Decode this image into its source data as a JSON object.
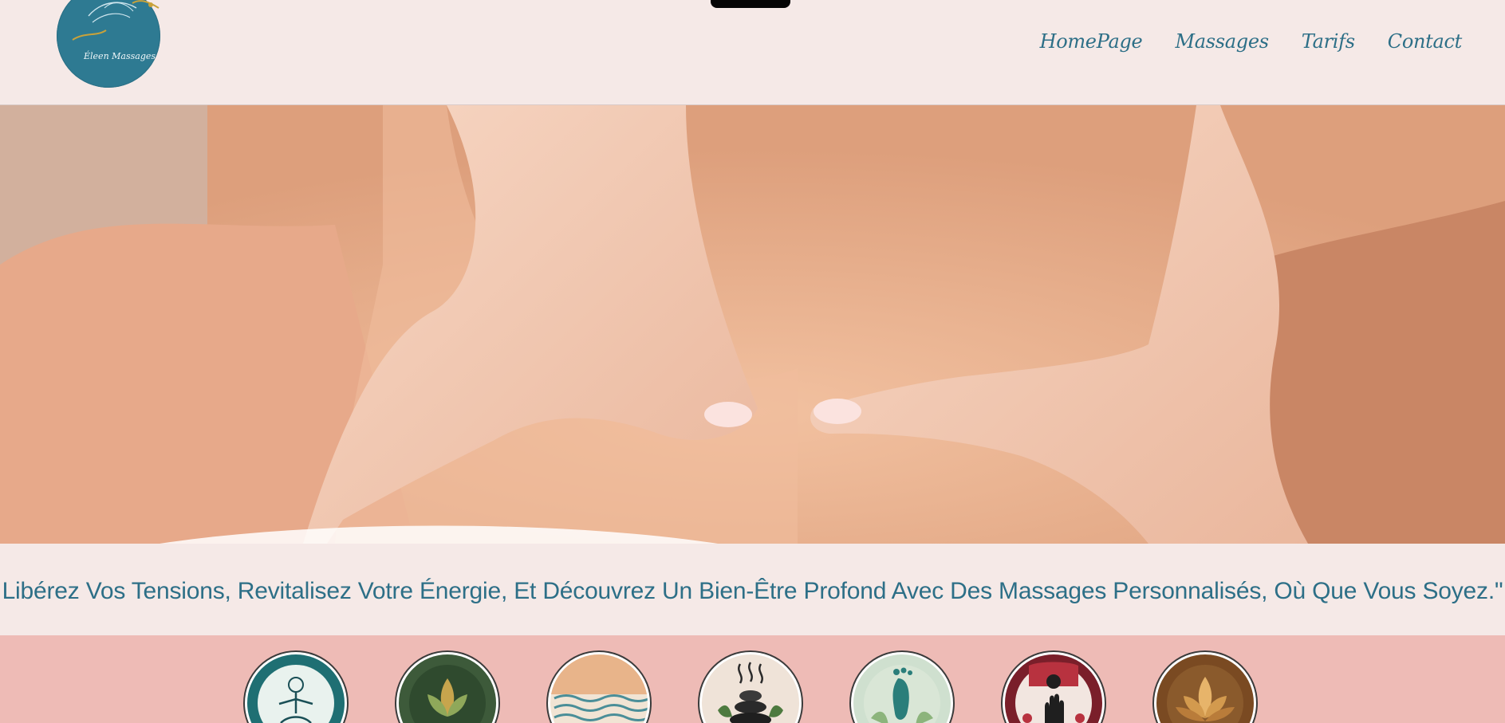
{
  "header": {
    "logo_text": "Éleen Massages",
    "nav": [
      {
        "label": "HomePage"
      },
      {
        "label": "Massages"
      },
      {
        "label": "Tarifs"
      },
      {
        "label": "Contact"
      }
    ]
  },
  "hero": {
    "image": "massage-hands-on-back-photo"
  },
  "tagline": {
    "text": "Libérez Vos Tensions, Revitalisez Votre Énergie, Et Découvrez Un Bien-Être Profond Avec Des Massages Personnalisés, Où Que Vous Soyez.\""
  },
  "icons": [
    {
      "name": "meditation-figure-icon",
      "bg": "#1f6f73"
    },
    {
      "name": "lotus-icon",
      "bg": "#3d5a3a"
    },
    {
      "name": "waves-icon",
      "bg": "#f1e4d4"
    },
    {
      "name": "stones-icon",
      "bg": "#efe3d8"
    },
    {
      "name": "foot-reflexology-icon",
      "bg": "#cfe0cf"
    },
    {
      "name": "hand-icon",
      "bg": "#7a1f2a"
    },
    {
      "name": "golden-lotus-icon",
      "bg": "#7a4a22"
    }
  ],
  "colors": {
    "brand": "#2d6f87",
    "background": "#f5e9e7",
    "band": "#eebbb6"
  }
}
